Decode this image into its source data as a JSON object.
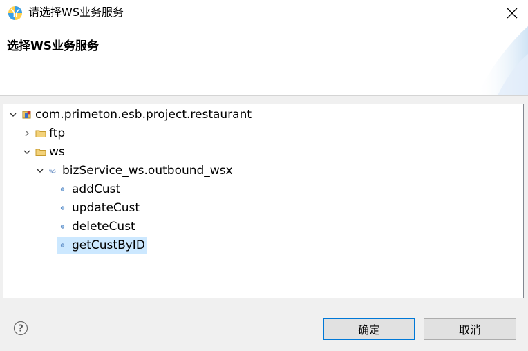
{
  "window": {
    "title": "请选择WS业务服务"
  },
  "header": {
    "title": "选择WS业务服务"
  },
  "tree": {
    "root": "com.primeton.esb.project.restaurant",
    "folder_ftp": "ftp",
    "folder_ws": "ws",
    "service": "bizService_ws.outbound_wsx",
    "operations": [
      "addCust",
      "updateCust",
      "deleteCust",
      "getCustByID"
    ],
    "selected": "getCustByID"
  },
  "buttons": {
    "ok": "确定",
    "cancel": "取消"
  },
  "icons": {
    "app": "app-logo-icon",
    "close": "close-icon",
    "help": "help-icon",
    "project": "project-icon",
    "folder": "folder-icon",
    "wsx": "ws-service-icon",
    "operation": "operation-icon"
  },
  "colors": {
    "accent": "#0078d7",
    "selection": "#cce8ff",
    "folder": "#e8c163"
  }
}
